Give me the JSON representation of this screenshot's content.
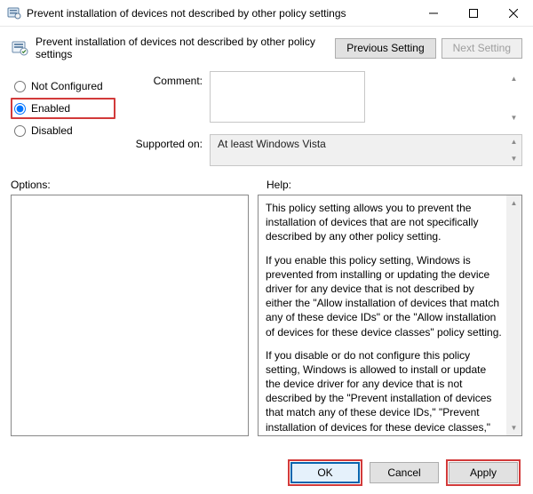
{
  "window": {
    "title": "Prevent installation of devices not described by other policy settings"
  },
  "header": {
    "policy_title": "Prevent installation of devices not described by other policy settings",
    "prev_label": "Previous Setting",
    "next_label": "Next Setting"
  },
  "state": {
    "not_configured": "Not Configured",
    "enabled": "Enabled",
    "disabled": "Disabled",
    "selected": "enabled"
  },
  "fields": {
    "comment_label": "Comment:",
    "comment_value": "",
    "supported_label": "Supported on:",
    "supported_value": "At least Windows Vista"
  },
  "panels": {
    "options_label": "Options:",
    "help_label": "Help:",
    "help_p1": "This policy setting allows you to prevent the installation of devices that are not specifically described by any other policy setting.",
    "help_p2": "If you enable this policy setting, Windows is prevented from installing or updating the device driver for any device that is not described by either the \"Allow installation of devices that match any of these device IDs\" or the \"Allow installation of devices for these device classes\" policy setting.",
    "help_p3": "If you disable or do not configure this policy setting, Windows is allowed to install or update the device driver for any device that is not described by the \"Prevent installation of devices that match any of these device IDs,\" \"Prevent installation of devices for these device classes,\" or \"Prevent installation of removable devices\" policy setting."
  },
  "footer": {
    "ok": "OK",
    "cancel": "Cancel",
    "apply": "Apply"
  }
}
